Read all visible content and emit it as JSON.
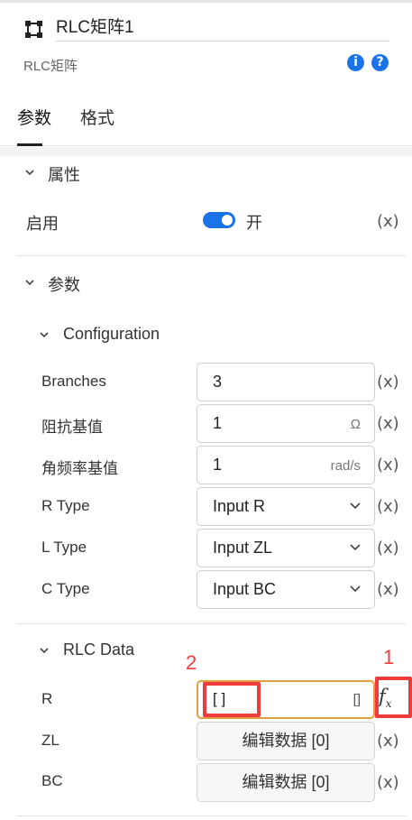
{
  "header": {
    "title": "RLC矩阵1",
    "subtitle": "RLC矩阵",
    "block_icon": "block-diagram-icon",
    "info_icon": "info-icon",
    "help_icon": "help-icon"
  },
  "tabs": [
    {
      "label": "参数",
      "active": true
    },
    {
      "label": "格式",
      "active": false
    }
  ],
  "sections": {
    "properties": {
      "title": "属性",
      "enable": {
        "label": "启用",
        "toggle_state": "开",
        "on": true,
        "var_label": "(x)"
      }
    },
    "parameters": {
      "title": "参数",
      "configuration": {
        "title": "Configuration",
        "rows": [
          {
            "label": "Branches",
            "value": "3",
            "unit": "",
            "type": "input",
            "var_label": "(x)"
          },
          {
            "label": "阻抗基值",
            "value": "1",
            "unit": "Ω",
            "type": "input",
            "var_label": "(x)"
          },
          {
            "label": "角频率基值",
            "value": "1",
            "unit": "rad/s",
            "type": "input",
            "var_label": "(x)"
          },
          {
            "label": "R Type",
            "value": "Input R",
            "type": "select",
            "var_label": "(x)"
          },
          {
            "label": "L Type",
            "value": "Input ZL",
            "type": "select",
            "var_label": "(x)"
          },
          {
            "label": "C Type",
            "value": "Input BC",
            "type": "select",
            "var_label": "(x)"
          }
        ]
      },
      "rlc_data": {
        "title": "RLC Data",
        "rows": [
          {
            "label": "R",
            "value": "[ ]",
            "suffix": "[]",
            "type": "expression"
          },
          {
            "label": "ZL",
            "button_label": "编辑数据 [0]",
            "var_label": "(x)"
          },
          {
            "label": "BC",
            "button_label": "编辑数据 [0]",
            "var_label": "(x)"
          }
        ]
      }
    }
  },
  "annotations": [
    {
      "number": "1",
      "target": "fx-icon"
    },
    {
      "number": "2",
      "target": "r-expression-input"
    }
  ],
  "colors": {
    "accent": "#1a73e8",
    "annotation_red": "#ef3b3b",
    "active_field_border": "#e0a040"
  }
}
